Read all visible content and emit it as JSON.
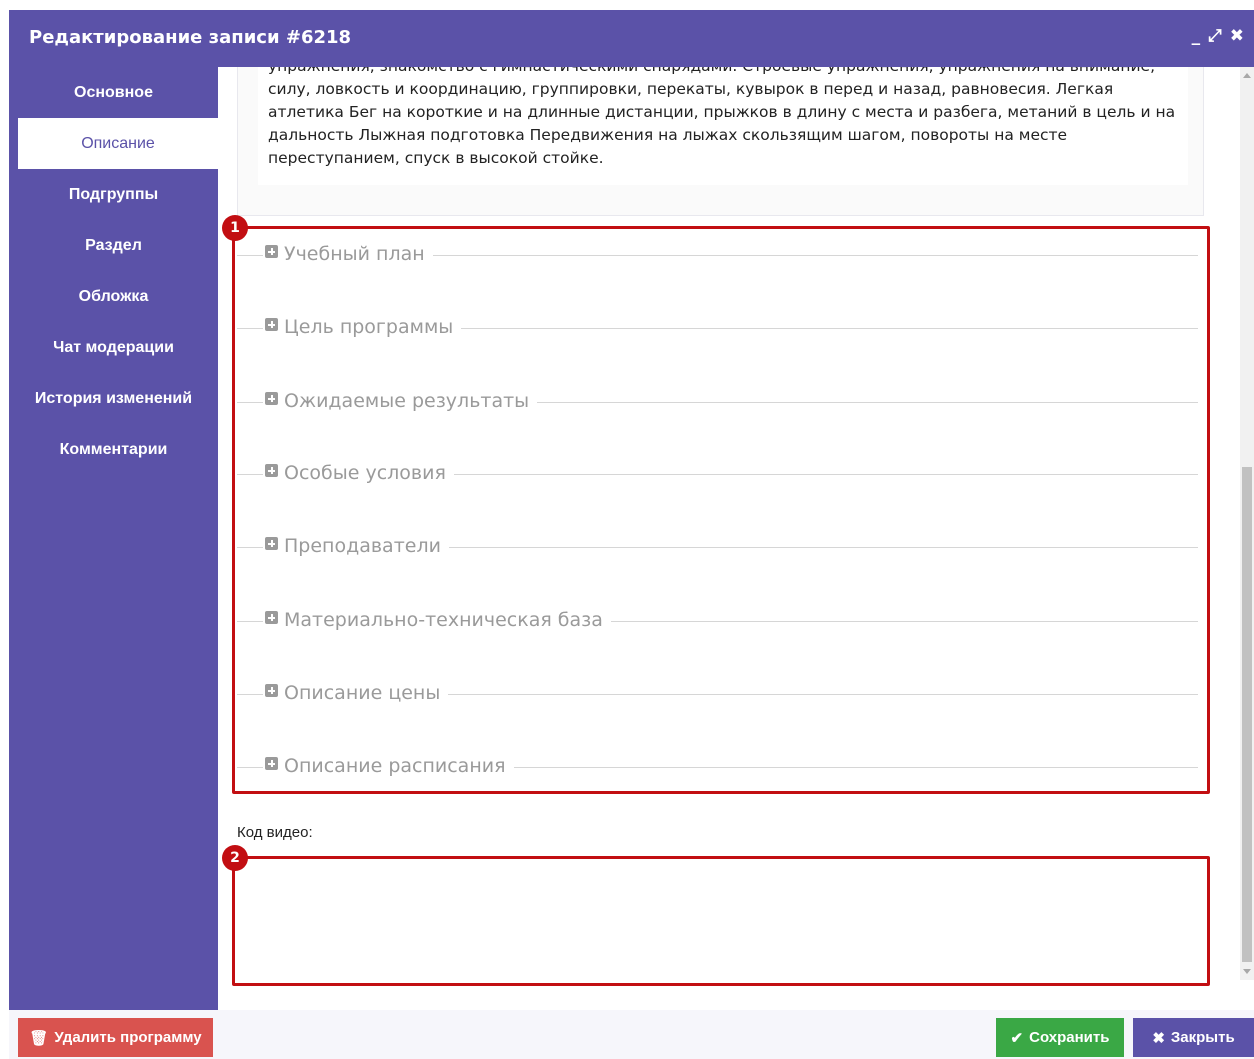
{
  "window": {
    "title": "Редактирование записи #6218",
    "controls": {
      "minimize": "_",
      "maximize": "⤢",
      "close": "✖"
    }
  },
  "sidebar": {
    "items": [
      {
        "label": "Основное"
      },
      {
        "label": "Описание"
      },
      {
        "label": "Подгруппы"
      },
      {
        "label": "Раздел"
      },
      {
        "label": "Обложка"
      },
      {
        "label": "Чат модерации"
      },
      {
        "label": "История изменений"
      },
      {
        "label": "Комментарии"
      }
    ],
    "active_index": 1
  },
  "description": {
    "text": "упражнения, знакомство с гимнастическими снарядами. Строевые упражнения, упражнения на внимание, силу, ловкость и координацию, группировки, перекаты, кувырок в перед и назад, равновесия. Легкая атлетика Бег на короткие и на длинные дистанции, прыжков в длину с места и разбега, метаний в цель и на дальность Лыжная подготовка Передвижения на лыжах скользящим шагом, повороты на месте переступанием, спуск в высокой стойке."
  },
  "sections": [
    {
      "label": "Учебный план"
    },
    {
      "label": "Цель программы"
    },
    {
      "label": "Ожидаемые результаты"
    },
    {
      "label": "Особые условия"
    },
    {
      "label": "Преподаватели"
    },
    {
      "label": "Материально-техническая база"
    },
    {
      "label": "Описание цены"
    },
    {
      "label": "Описание расписания"
    }
  ],
  "video": {
    "label": "Код видео:",
    "value": ""
  },
  "annotations": [
    {
      "number": "1"
    },
    {
      "number": "2"
    }
  ],
  "footer": {
    "delete_label": "Удалить программу",
    "save_label": "Сохранить",
    "close_label": "Закрыть"
  },
  "colors": {
    "primary": "#5b52a8",
    "danger": "#d9534f",
    "success": "#3aa845",
    "annotation": "#c20e12"
  }
}
